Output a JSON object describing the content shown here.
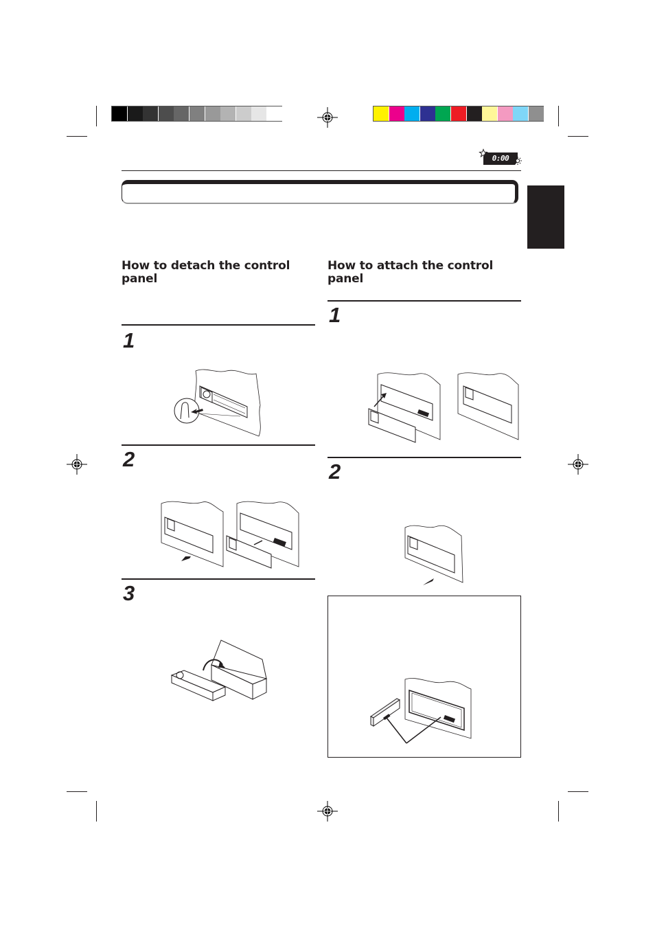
{
  "registration": {
    "grayscale_swatches": [
      "#000000",
      "#1a1a1a",
      "#333333",
      "#4d4d4d",
      "#666666",
      "#808080",
      "#999999",
      "#b3b3b3",
      "#cccccc",
      "#e6e6e6",
      "#ffffff"
    ],
    "color_swatches": [
      "#fff200",
      "#ec008c",
      "#00aeef",
      "#2e3192",
      "#00a651",
      "#ed1c24",
      "#231f20",
      "#fff799",
      "#f49ac1",
      "#7fd6f7",
      "#8f8f8f"
    ]
  },
  "header": {
    "clock_icon_text": "0:00",
    "title": ""
  },
  "left_section": {
    "heading": "How to detach the control panel",
    "steps": [
      {
        "number": "1",
        "illustration": "press-release-button"
      },
      {
        "number": "2",
        "illustration": "pull-out-panel"
      },
      {
        "number": "3",
        "illustration": "put-in-case"
      }
    ]
  },
  "right_section": {
    "heading": "How to attach the control panel",
    "steps": [
      {
        "number": "1",
        "illustration": "insert-left-side"
      },
      {
        "number": "2",
        "illustration": "press-right-side"
      }
    ],
    "note_illustration": "connectors"
  }
}
